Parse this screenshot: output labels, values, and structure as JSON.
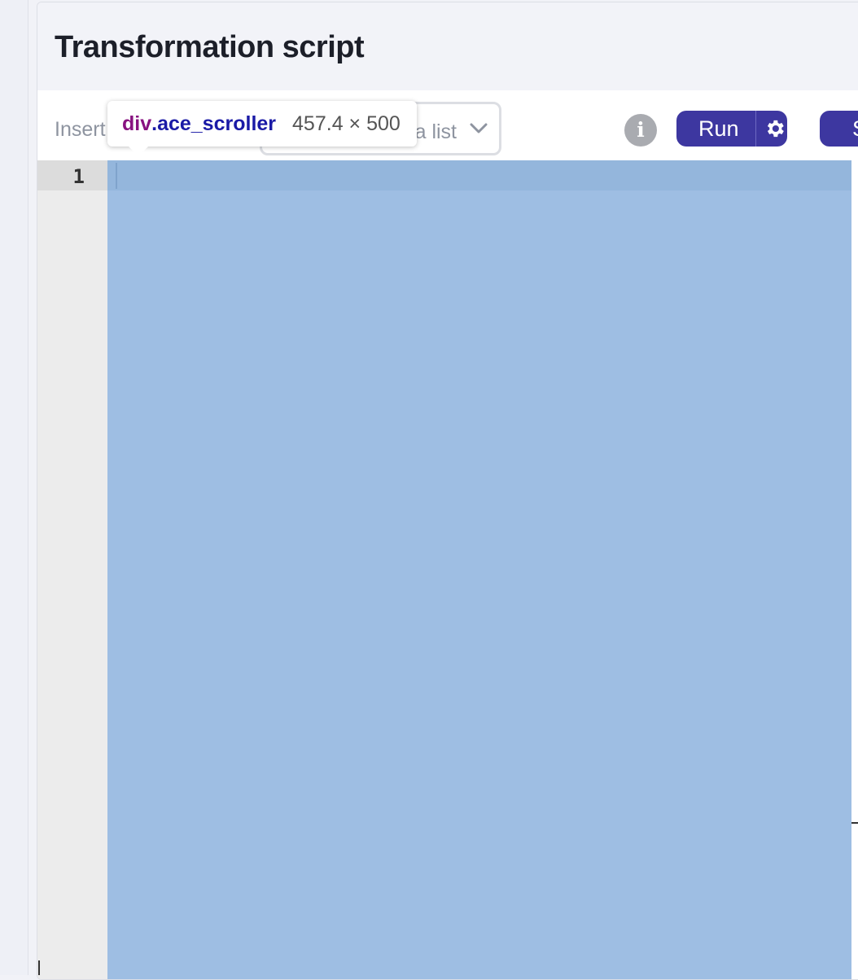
{
  "panel": {
    "title": "Transformation script"
  },
  "toolbar": {
    "insert_label": "Insert",
    "dropdown_visible_text": "a list",
    "run_label": "Run",
    "second_button_label": "S"
  },
  "editor": {
    "line_numbers": [
      "1"
    ]
  },
  "inspector_tooltip": {
    "tag": "div",
    "class_name": ".ace_scroller",
    "size": "457.4 × 500"
  },
  "icons": {
    "dropdown_chevron": "chevron-down-icon",
    "info": "info-icon",
    "settings": "gear-icon"
  },
  "colors": {
    "accent": "#3d37a0",
    "selection_highlight": "#9ebee3",
    "tooltip_tag": "#881280",
    "tooltip_class": "#1a1aa6"
  }
}
